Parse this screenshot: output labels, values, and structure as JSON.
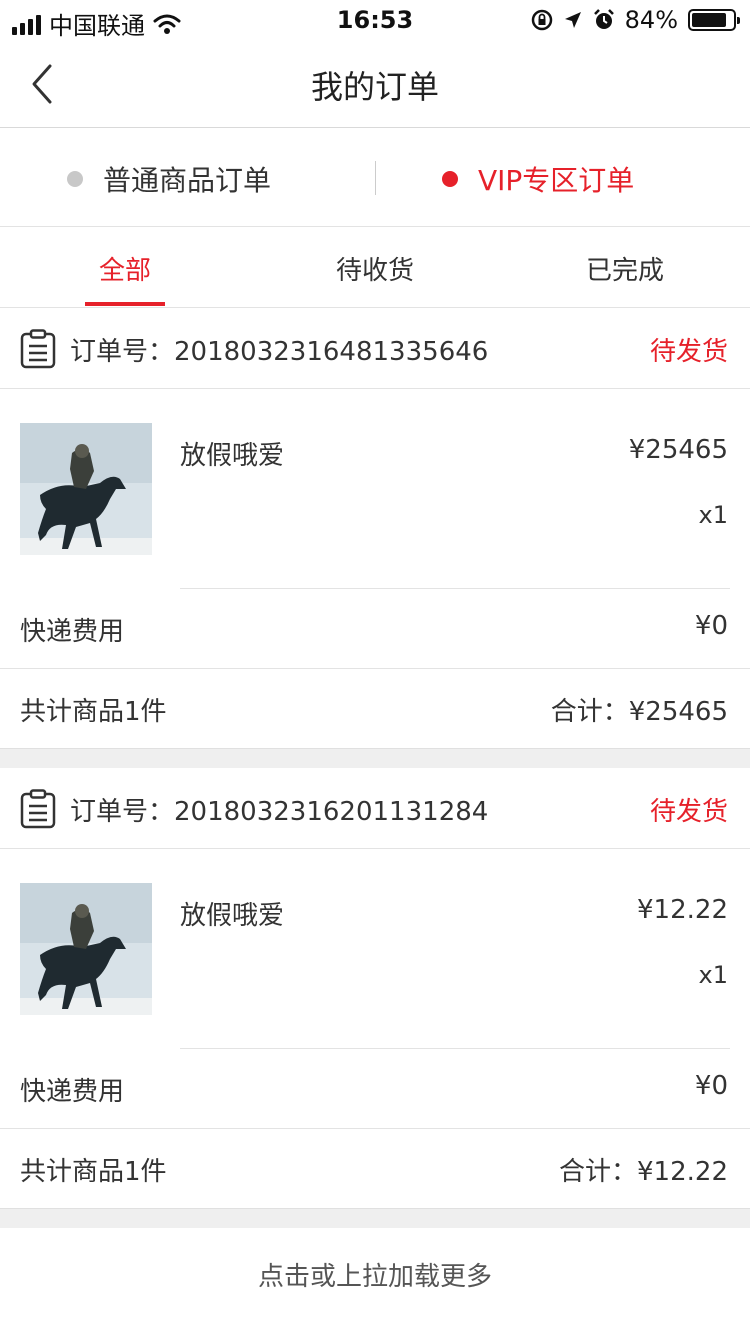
{
  "status_bar": {
    "carrier": "中国联通",
    "time": "16:53",
    "battery_percent": "84%",
    "battery_level": 0.84,
    "icons": [
      "signal-icon",
      "wifi-icon",
      "rotation-lock-icon",
      "location-icon",
      "alarm-icon",
      "battery-icon"
    ]
  },
  "nav": {
    "title": "我的订单",
    "back_icon": "chevron-left-icon"
  },
  "categories": {
    "normal_label": "普通商品订单",
    "vip_label": "VIP专区订单",
    "active": "vip"
  },
  "tabs": [
    {
      "label": "全部",
      "active": true
    },
    {
      "label": "待收货",
      "active": false
    },
    {
      "label": "已完成",
      "active": false
    }
  ],
  "colors": {
    "accent": "#e6212a",
    "inactive_dot": "#c8c8c8",
    "divider": "#e3e3e3",
    "gap_bg": "#efefef"
  },
  "orders": [
    {
      "order_no_label": "订单号：",
      "order_no": "2018032316481335646",
      "status": "待发货",
      "item_name": "放假哦爱",
      "item_price": "¥25465",
      "item_qty": "x1",
      "shipping_label": "快递费用",
      "shipping_fee": "¥0",
      "count_label": "共计商品1件",
      "total": "合计：¥25465"
    },
    {
      "order_no_label": "订单号：",
      "order_no": "2018032316201131284",
      "status": "待发货",
      "item_name": "放假哦爱",
      "item_price": "¥12.22",
      "item_qty": "x1",
      "shipping_label": "快递费用",
      "shipping_fee": "¥0",
      "count_label": "共计商品1件",
      "total": "合计：¥12.22"
    }
  ],
  "load_more": "点击或上拉加载更多"
}
